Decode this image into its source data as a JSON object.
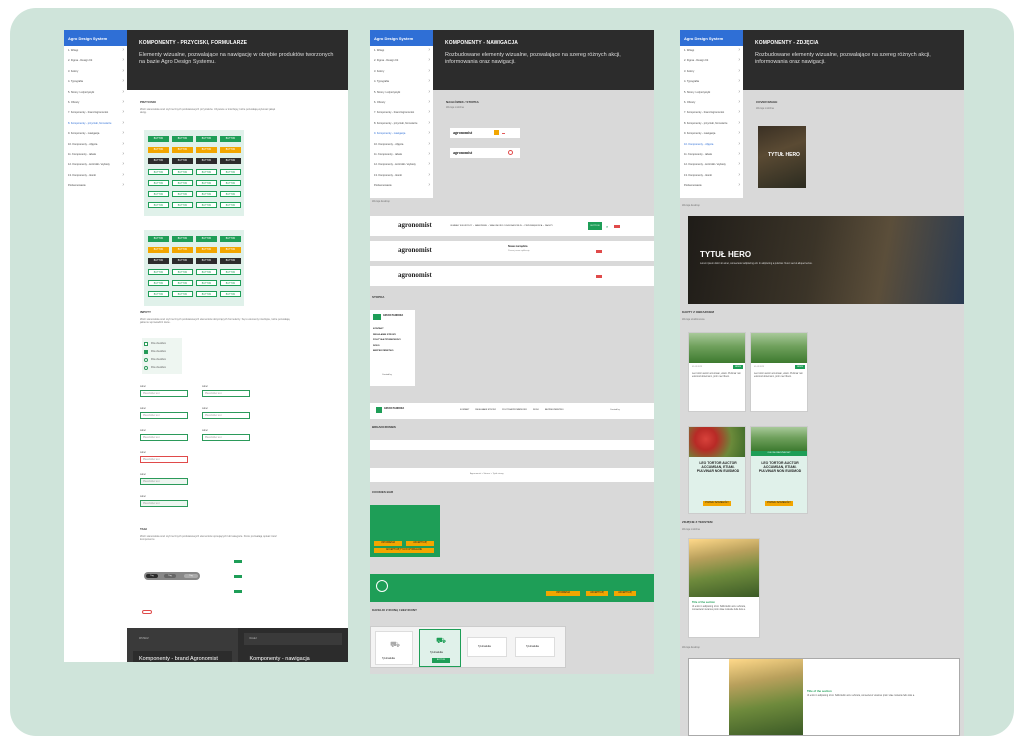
{
  "p1": {
    "sidebar_title": "Agro Design System",
    "sidebar_items": [
      "1. Wstęp",
      "2. Figma - Design Kit",
      "3. Kolory",
      "4. Typografia",
      "5. Strony / edytorystyki",
      "6. Obrazy",
      "7. Komponenty - brand Agronomist",
      "8. Komponenty - przyciski, formularze",
      "9. Komponenty - nawigacja",
      "10. Komponenty - zdjęcia",
      "11. Komponenty - tabele",
      "12. Komponenty - kontrolki / etykiety",
      "13. Komponenty - ikonki",
      "Podsumowanie"
    ],
    "active_index": 7,
    "title": "KOMPONENTY - PRZYCISKI, FORMULARZE",
    "desc": "Elementy wizualne, pozwalające na nawigację w obrębie produktów tworzonych na bazie Agro Design Systemu.",
    "sec_buttons": "PRZYCISKI",
    "sec_buttons_txt": "Zbiór stanowiska oraz styli recznych podstawowych przycisków. Używane w interfejsy, które pozwalają wykonać jakąś akcję.",
    "button_label": "BUTTON",
    "sec_inputs": "INPUTY",
    "sec_inputs_txt": "Zbiór stanowiska oraz styli recznych podstawowych elementów dotyczących formularzy. Są to elementy interfejsu, które pozwalają jakiemu wprowadzić dane.",
    "checkbox_label": "Pole checkbox",
    "field_label": "Label",
    "field_placeholder": "Placeholder text",
    "sec_tags": "TAGI",
    "sec_tags_txt": "Zbiór stanowiska oraz styli recznych podstawowych elementów opisujących lub kategorie. Które pozwalają opisać treść komponentu.",
    "tag_label": "Tag",
    "footer_prev_small": "WSTECZ",
    "footer_prev": "Komponenty - brand Agronomist",
    "footer_next_small": "DALEJ",
    "footer_next": "Komponenty - nawigacja"
  },
  "p2": {
    "sidebar_title": "Agro Design System",
    "active_index": 8,
    "title": "KOMPONENTY - NAWIGACJA",
    "desc": "Rozbudowane elementy wizualne, pozwalające na szereg różnych akcji, informowania oraz nawigacji.",
    "sec_search": "NAGŁÓWEK / STOPKA",
    "search_caption": "Wersja mobilna",
    "brand": "agronomist",
    "desktop_caption": "Wersja desktop",
    "nav_links": "ODMIANY KUKURYDZY ⌄   NAWOŻENIE ⌄   WIADOMOŚCI   OCHRONA ROŚLIN ⌄   PRZEDSIĘBIORCA ⌄   ZAKUPY",
    "nav_button": "BUTTON",
    "notice_title": "Nowe narzędzia",
    "notice_sub": "Poznaj nowe aplikacje",
    "sec_footer": "STOPKA",
    "footer_links": [
      "KONTAKT",
      "REGULAMIN STRONY",
      "POLITYKA PRYWATNOŚCI",
      "RODO",
      "BEZPIECZEŃSTWO"
    ],
    "created_by": "Created by",
    "footer_logo": "GRUPA PANDORA",
    "sec_breadcrumbs": "BREADCRUMBS",
    "crumbs": "Agronomist  >  Strona  >  Tytuł strony",
    "sec_cookies": "COOKIES BAR",
    "cookies_btn1": "USTAWIENIA",
    "cookies_btn2": "AKCEPTUJĘ",
    "cookies_btn3": "AKCEPTUJĘ TYLKO WYMAGANE",
    "sec_tiles": "KAFELKI Z IKONĄ I BEZ IKONY",
    "tile_label": "Tytuł kafelka",
    "tile_btn": "BUTTON"
  },
  "p3": {
    "sidebar_title": "Agro Design System",
    "active_index": 9,
    "title": "KOMPONENTY - ZDJĘCIA",
    "desc": "Rozbudowane elementy wizualne, pozwalające na szereg różnych akcji, informowania oraz nawigacji.",
    "sec_cover": "COVER IMAGE",
    "cover_caption": "Wersja mobilna",
    "cover_title": "TYTUŁ HERO",
    "desktop_caption": "Wersja desktop",
    "hero_title": "TYTUŁ HERO",
    "hero_txt": "Lorem ipsum dolor sit amet, consectetur adipiscing elit. In adipiscing a pulvinar. Nunc sed ut aliquet lectus.",
    "sec_cards": "KARTY Z OBRAZKIEM",
    "cards_caption": "Wersja szablonowa",
    "card_meta": "01.03.2023",
    "card_badge": "NEWS",
    "card_text": "Leo tortor auctor accumsan, etiam. Pulvinar non euismod donetnunc, proin nec libero.",
    "promo_title": "LEO TORTOR AUCTOR ACCUMSAN, ETIAM. PULVINAR NON EUISMOD",
    "promo_btn": "POZNAJ SZCZEGÓŁY",
    "promo_badge": "OLEJ SŁONECZNIKOWY",
    "sec_text": "ZDJĘCIE Z TEKSTEM",
    "text_caption": "Wersja mobilna",
    "feat_title": "Title of the section",
    "feat_txt": "Ut enim in adipiscing id sit. Sollicitudin arcu vehicula, consectetur vivamus proin vitae molestie felis duis a.",
    "desktop_caption2": "Wersja desktop"
  },
  "colors": {
    "green": "#1e9e57",
    "orange": "#f2a600",
    "dark": "#2c2c2c",
    "blue": "#2f6fd6",
    "mint": "#cfe4da"
  }
}
